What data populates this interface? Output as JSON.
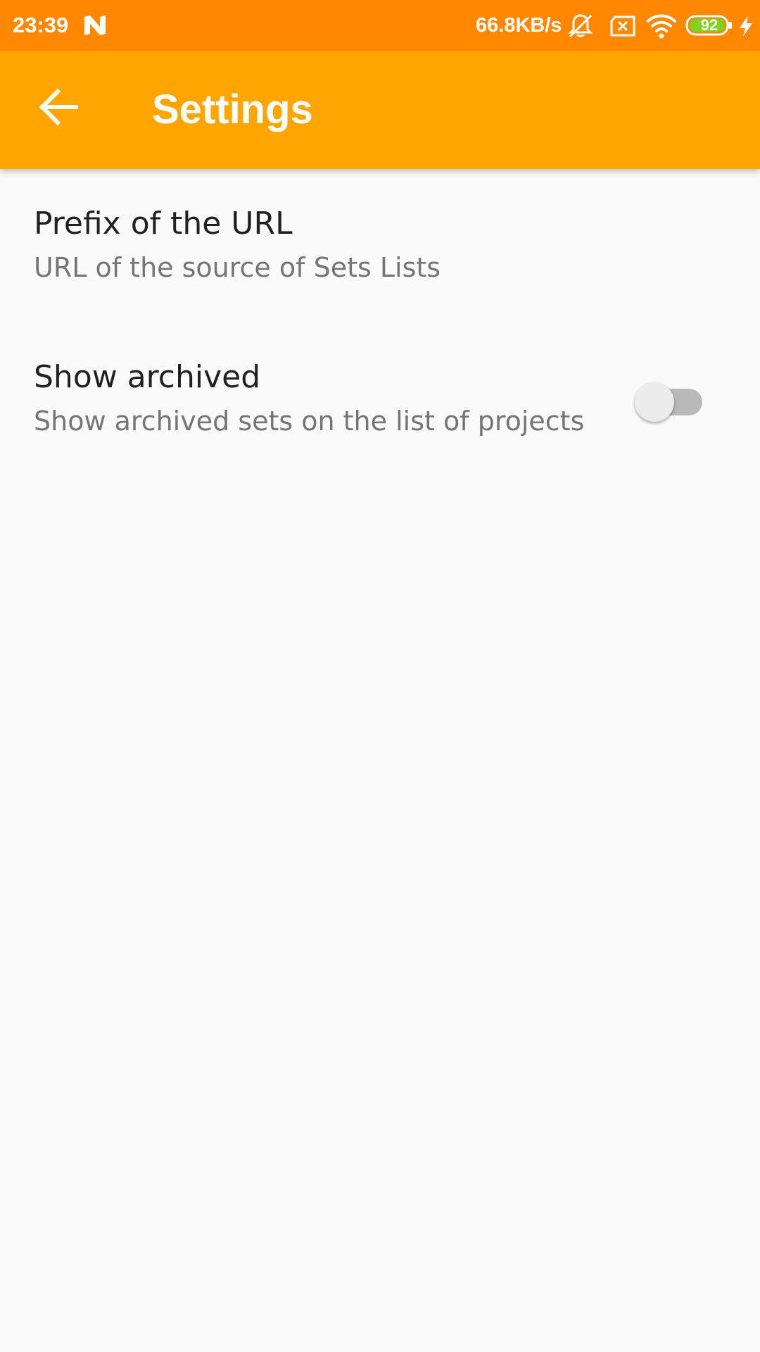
{
  "status_bar": {
    "time": "23:39",
    "network_speed": "66.8KB/s",
    "battery_level": "92",
    "icons": [
      "n-notification-icon",
      "bell-muted-icon",
      "sim-x-icon",
      "wifi-icon",
      "battery-icon",
      "charging-bolt-icon"
    ]
  },
  "app_bar": {
    "title": "Settings",
    "back_icon": "arrow-back-icon",
    "color": "#ffa500"
  },
  "preferences": [
    {
      "title": "Prefix of the URL",
      "summary": "URL of the source of Sets Lists"
    },
    {
      "title": "Show archived",
      "summary": "Show archived sets on the list of projects",
      "toggle_on": false
    }
  ],
  "colors": {
    "status_bar": "#ff8800",
    "app_bar": "#ffa500",
    "background": "#fafafa",
    "battery_fill": "#7ed321"
  }
}
